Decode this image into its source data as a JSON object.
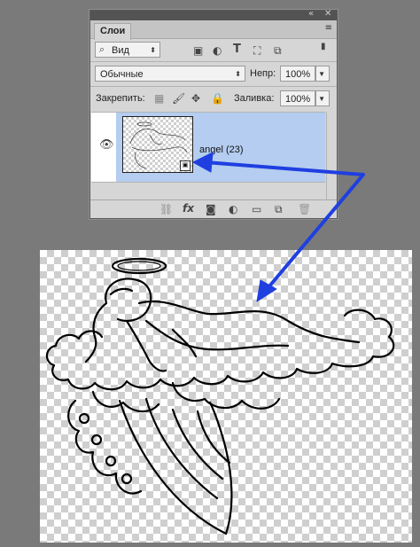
{
  "panel": {
    "title": "Слои",
    "top_controls": "◂◂  ✕",
    "menu_icon": "≡",
    "filter_label": "Вид",
    "blend_mode": "Обычные",
    "opacity_label": "Непр:",
    "opacity_value": "100%",
    "lock_label": "Закрепить:",
    "fill_label": "Заливка:",
    "fill_value": "100%"
  },
  "layer": {
    "name": "angel (23)",
    "visible": true
  },
  "bottom_icons": [
    "link-icon",
    "fx-icon",
    "mask-icon",
    "adjustment-icon",
    "folder-icon",
    "new-layer-icon",
    "trash-icon"
  ],
  "colors": {
    "panel_bg": "#d6d6d6",
    "selection": "#b4cdf0",
    "arrow": "#1f3fe0",
    "workspace": "#7a7a7a"
  }
}
